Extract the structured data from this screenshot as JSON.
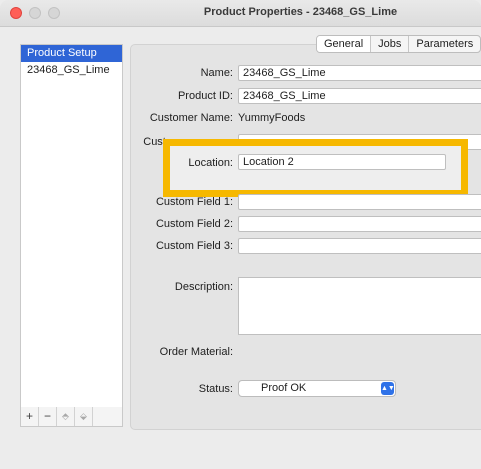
{
  "window": {
    "title": "Product Properties - 23468_GS_Lime"
  },
  "sidebar": {
    "items": [
      {
        "label": "Product Setup",
        "selected": true
      },
      {
        "label": "23468_GS_Lime",
        "selected": false
      }
    ],
    "toolbar": {
      "add": "+",
      "remove": "−",
      "up": "⬘",
      "down": "⬙"
    }
  },
  "tabs": [
    {
      "label": "General",
      "active": true
    },
    {
      "label": "Jobs",
      "active": false
    },
    {
      "label": "Parameters",
      "active": false
    }
  ],
  "form": {
    "name_label": "Name:",
    "name_value": "23468_GS_Lime",
    "product_id_label": "Product ID:",
    "product_id_value": "23468_GS_Lime",
    "customer_name_label": "Customer Name:",
    "customer_name_value": "YummyFoods",
    "customer_partial_label": "Custo",
    "location_label": "Location:",
    "location_value": "Location 2",
    "custom1_label": "Custom Field 1:",
    "custom1_value": "",
    "custom2_label": "Custom Field 2:",
    "custom2_value": "",
    "custom3_label": "Custom Field 3:",
    "custom3_value": "",
    "description_label": "Description:",
    "description_value": "",
    "order_material_label": "Order Material:",
    "status_label": "Status:",
    "status_value": "Proof OK"
  },
  "colors": {
    "highlight": "#f6b800",
    "selection": "#2f65d6",
    "close": "#ff5f57"
  }
}
